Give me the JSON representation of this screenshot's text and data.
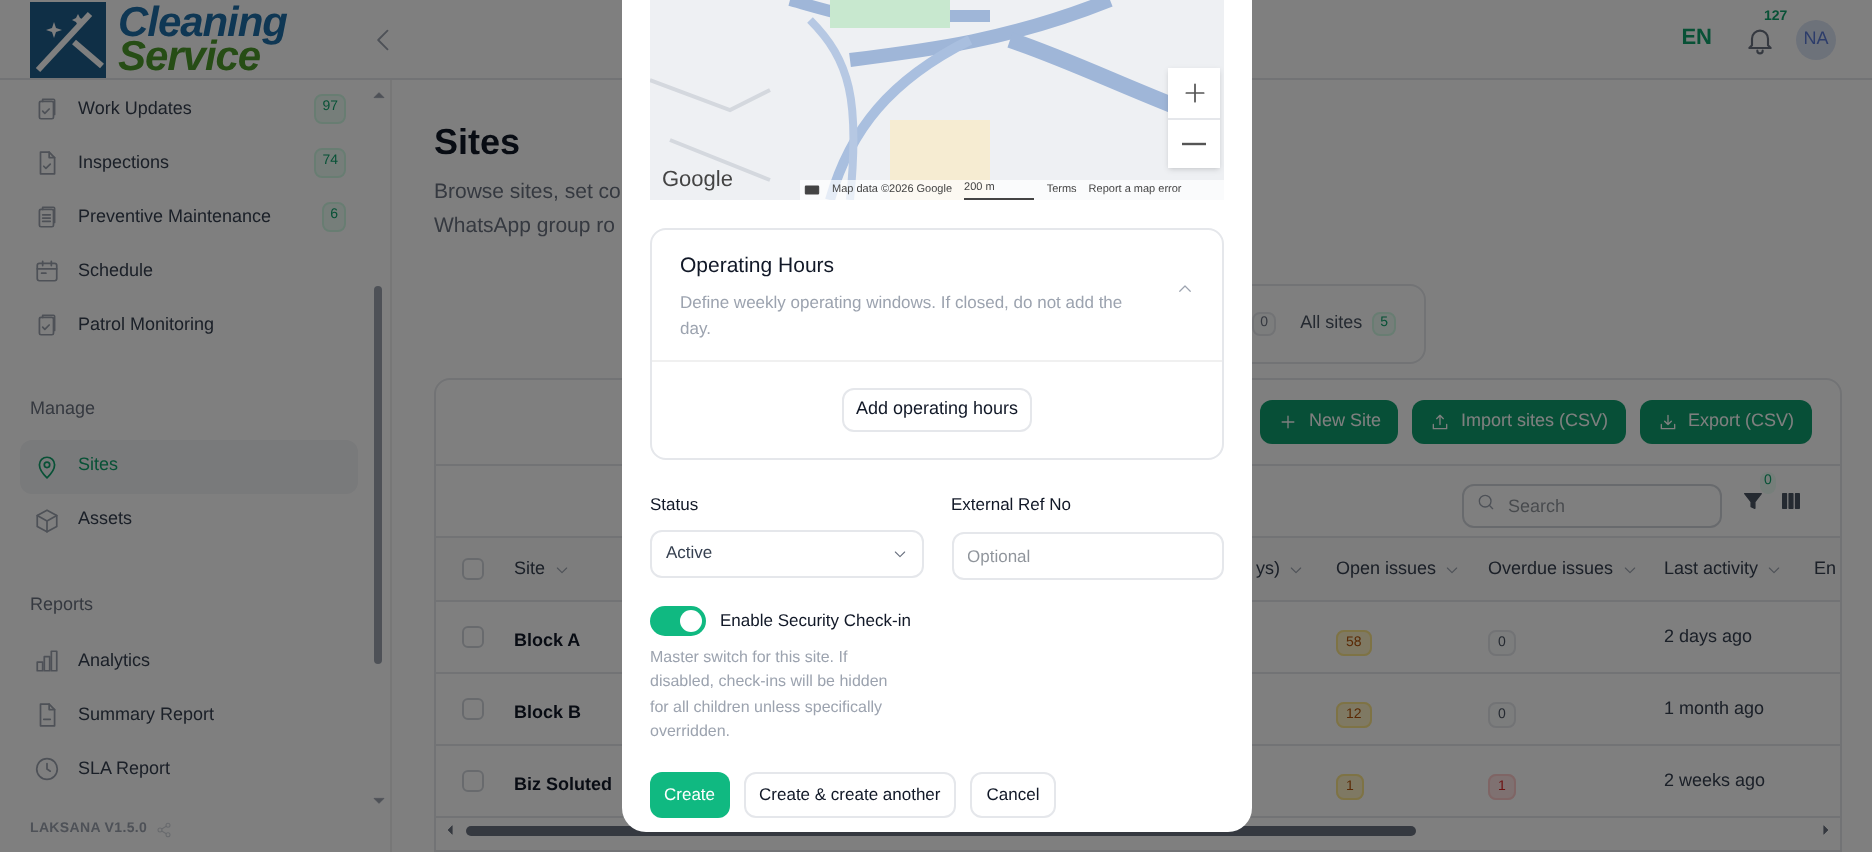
{
  "header": {
    "logo_line_1": "Cleaning",
    "logo_line_2": "Service",
    "language": "EN",
    "notification_count": "127",
    "avatar_initials": "NA"
  },
  "sidebar": {
    "groups": [
      {
        "items": [
          {
            "label": "Work Updates",
            "badge": "97",
            "selected": false
          },
          {
            "label": "Inspections",
            "badge": "74",
            "selected": false
          },
          {
            "label": "Preventive Maintenance",
            "badge": "6",
            "selected": false
          },
          {
            "label": "Schedule",
            "selected": false
          },
          {
            "label": "Patrol Monitoring",
            "selected": false
          }
        ]
      },
      {
        "title": "Manage",
        "items": [
          {
            "label": "Sites",
            "selected": true
          },
          {
            "label": "Assets",
            "selected": false
          }
        ]
      },
      {
        "title": "Reports",
        "items": [
          {
            "label": "Analytics",
            "selected": false
          },
          {
            "label": "Summary Report",
            "selected": false
          },
          {
            "label": "SLA Report",
            "selected": false
          }
        ]
      }
    ],
    "version": "LAKSANA V1.5.0"
  },
  "page": {
    "title": "Sites",
    "description_lines": [
      "Browse sites, set co",
      "WhatsApp group ro"
    ],
    "filter_tabs": [
      {
        "count": "0"
      },
      {
        "label": "All sites",
        "count": "5"
      }
    ],
    "actions": [
      "New Site",
      "Import sites (CSV)",
      "Export (CSV)"
    ],
    "search": {
      "placeholder": "Search"
    },
    "filter_count": "0",
    "table": {
      "all_selected": false,
      "columns": [
        "Site",
        "ys)",
        "Open issues",
        "Overdue issues",
        "Last activity",
        "En"
      ],
      "rows": [
        {
          "selected": false,
          "site": "Block A",
          "open_issues": "58",
          "overdue_issues": "0",
          "overdue_alert": false,
          "last_activity": "2 days ago"
        },
        {
          "selected": false,
          "site": "Block B",
          "open_issues": "12",
          "overdue_issues": "0",
          "overdue_alert": false,
          "last_activity": "1 month ago"
        },
        {
          "selected": false,
          "site": "Biz Soluted",
          "open_issues": "1",
          "overdue_issues": "1",
          "overdue_alert": true,
          "last_activity": "2 weeks ago"
        }
      ]
    }
  },
  "modal": {
    "map": {
      "logo": "Google",
      "attribution": "Map data ©2026 Google",
      "scale": "200 m",
      "terms": "Terms",
      "report": "Report a map error"
    },
    "operating_hours": {
      "title": "Operating Hours",
      "description": "Define weekly operating windows. If closed, do not add the day.",
      "expanded": true,
      "button": "Add operating hours"
    },
    "status": {
      "label": "Status",
      "value": "Active"
    },
    "external_ref": {
      "label": "External Ref No",
      "placeholder": "Optional"
    },
    "security_checkin": {
      "label": "Enable Security Check-in",
      "on": true,
      "help": "Master switch for this site. If disabled, check-ins will be hidden for all children unless specifically overridden."
    },
    "buttons": [
      {
        "label": "Create",
        "kind": "primary"
      },
      {
        "label": "Create & create another",
        "kind": "secondary"
      },
      {
        "label": "Cancel",
        "kind": "secondary"
      }
    ]
  }
}
